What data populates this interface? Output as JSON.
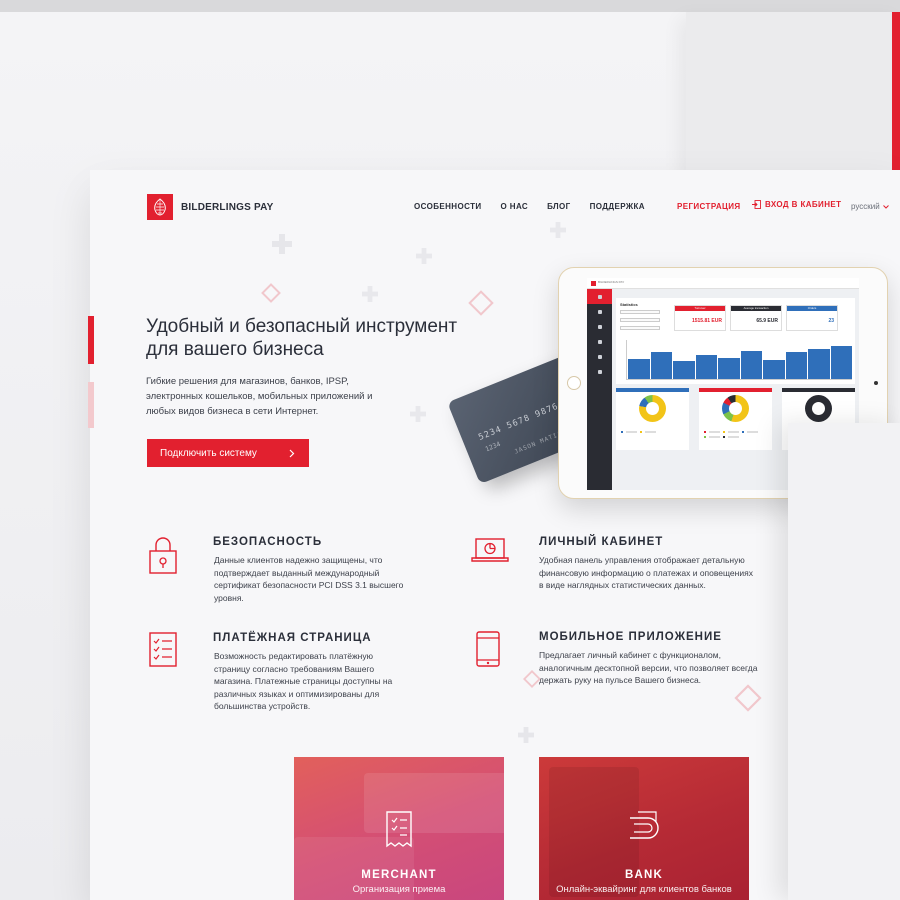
{
  "header": {
    "brand": "BILDERLINGS PAY",
    "nav": [
      "ОСОБЕННОСТИ",
      "О НАС",
      "БЛОГ",
      "ПОДДЕРЖКА"
    ],
    "register": "РЕГИСТРАЦИЯ",
    "login": "ВХОД В КАБИНЕТ",
    "language": "русский"
  },
  "hero": {
    "title": "Удобный и безопасный инструмент для вашего бизнеса",
    "description": "Гибкие решения для магазинов, банков, IPSP, электронных кошельков, мобильных приложений и любых видов бизнеса в сети Интернет.",
    "cta": "Подключить систему"
  },
  "card": {
    "number": "5234 5678 9876",
    "small": "1234",
    "holder": "JASON MATIANS"
  },
  "dashboard": {
    "title": "Statistics",
    "kpis": [
      {
        "label": "Turnover",
        "value": "1515.81 EUR",
        "color": "#e2202f"
      },
      {
        "label": "Average transaction",
        "value": "65.9 EUR",
        "color": "#2a2c33"
      },
      {
        "label": "Orders",
        "value": "23",
        "color": "#2f6fba"
      }
    ],
    "bars": [
      0.52,
      0.7,
      0.45,
      0.62,
      0.55,
      0.72,
      0.48,
      0.7,
      0.78,
      0.85
    ]
  },
  "features": [
    {
      "title": "БЕЗОПАСНОСТЬ",
      "text": "Данные клиентов надежно защищены, что подтверждает выданный международный сертификат безопасности PCI DSS 3.1 высшего уровня.",
      "icon": "lock-icon"
    },
    {
      "title": "ЛИЧНЫЙ КАБИНЕТ",
      "text": "Удобная панель управления отображает детальную финансовую информацию о платежах и оповещениях в виде наглядных статистических данных.",
      "icon": "laptop-chart-icon"
    },
    {
      "title": "ПЛАТЁЖНАЯ СТРАНИЦА",
      "text": "Возможность редактировать платёжную страницу согласно требованиям Вашего магазина. Платежные страницы доступны на различных языках и оптимизированы для большинства устройств.",
      "icon": "checklist-icon"
    },
    {
      "title": "МОБИЛЬНОЕ ПРИЛОЖЕНИЕ",
      "text": "Предлагает личный кабинет с функционалом, аналогичным десктопной версии, что позволяет всегда держать руку на пульсе Вашего бизнеса.",
      "icon": "tablet-icon"
    }
  ],
  "tiles": [
    {
      "title": "MERCHANT",
      "text": "Организация приема",
      "icon": "receipt-icon"
    },
    {
      "title": "BANK",
      "text": "Онлайн-эквайринг для клиентов банков",
      "icon": "card-swipe-icon"
    }
  ],
  "colors": {
    "accent": "#e2202f",
    "text": "#2b2f3a",
    "chart_blue": "#2f6fba"
  }
}
